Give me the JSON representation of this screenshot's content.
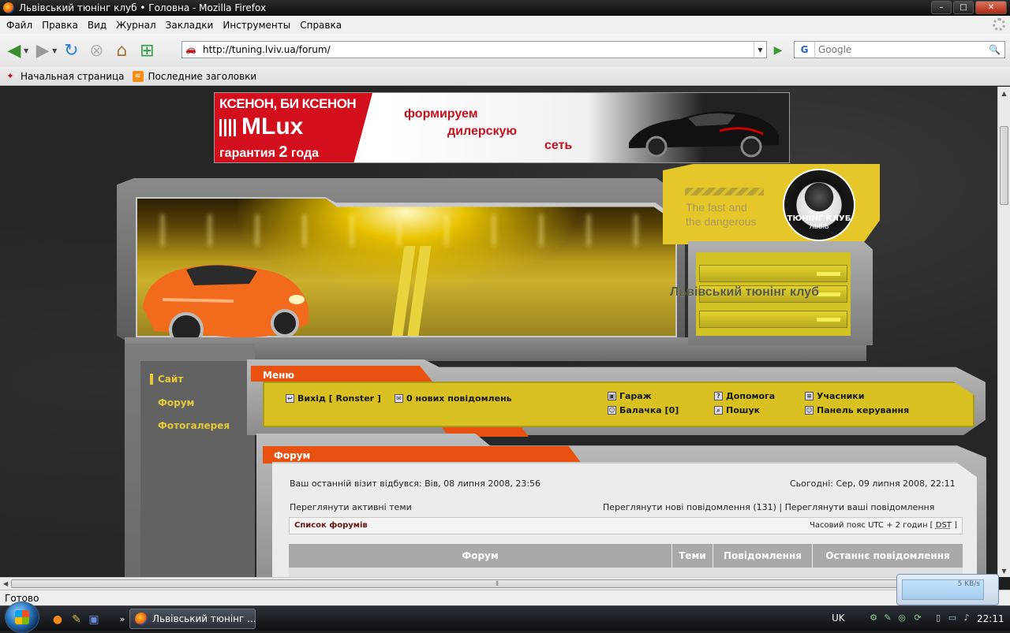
{
  "window": {
    "title": "Львівський тюнінг клуб • Головна - Mozilla Firefox",
    "btn_min": "–",
    "btn_max": "□",
    "btn_close": "✕"
  },
  "menubar": {
    "items": [
      "Файл",
      "Правка",
      "Вид",
      "Журнал",
      "Закладки",
      "Инструменты",
      "Справка"
    ]
  },
  "navbar": {
    "url": "http://tuning.lviv.ua/forum/",
    "search_placeholder": "Google",
    "search_engine": "G"
  },
  "bookmarks": {
    "items": [
      "Начальная страница",
      "Последние заголовки"
    ]
  },
  "ad": {
    "line1": "КСЕНОН, БИ КСЕНОН",
    "line2": "MLux",
    "line3_pre": "гарантия ",
    "line3_num": "2",
    "line3_post": " года",
    "slogan1": "формируем",
    "slogan2": "дилерскую",
    "slogan3": "сеть"
  },
  "logo": {
    "tagline1": "The fast and",
    "tagline2": "the dangerous",
    "emblem_title": "ТЮНІНГ КЛУБ",
    "emblem_city": "ЛЬВІВ"
  },
  "site_name": "Львівський тюнінг клуб",
  "leftnav": {
    "items": [
      "Сайт",
      "Форум",
      "Фотогалерея"
    ]
  },
  "menu": {
    "title": "Меню",
    "logout": "Вихід [ Ronster ]",
    "new_pm": "0 нових повідомлень",
    "garage": "Гараж",
    "chat": "Балачка [0]",
    "help": "Допомога",
    "search": "Пошук",
    "members": "Учасники",
    "ucp": "Панель керування"
  },
  "forum": {
    "title": "Форум",
    "last_visit": "Ваш останній візит відбувся: Вів, 08 липня 2008, 23:56",
    "today": "Сьогодні: Сер, 09 липня 2008, 22:11",
    "active_topics": "Переглянути активні теми",
    "new_posts": "Переглянути нові повідомлення (131)",
    "separator": " | ",
    "your_posts": "Переглянути ваші повідомлення",
    "forum_list": "Список форумів",
    "timezone_pre": "Часовий пояс UTC + 2 годин [ ",
    "timezone_dst": "DST",
    "timezone_post": " ]",
    "columns": [
      "Форум",
      "Теми",
      "Повідомлення",
      "Останнє повідомлення"
    ]
  },
  "status": {
    "text": "Готово",
    "net_speed": "5 KB/s"
  },
  "taskbar": {
    "task_label": "Львівський тюнінг ...",
    "lang": "UK",
    "clock": "22:11",
    "more": "»"
  },
  "colors": {
    "accent_orange": "#e85110",
    "accent_yellow": "#d8c120",
    "nav_link": "#e4c93a"
  }
}
